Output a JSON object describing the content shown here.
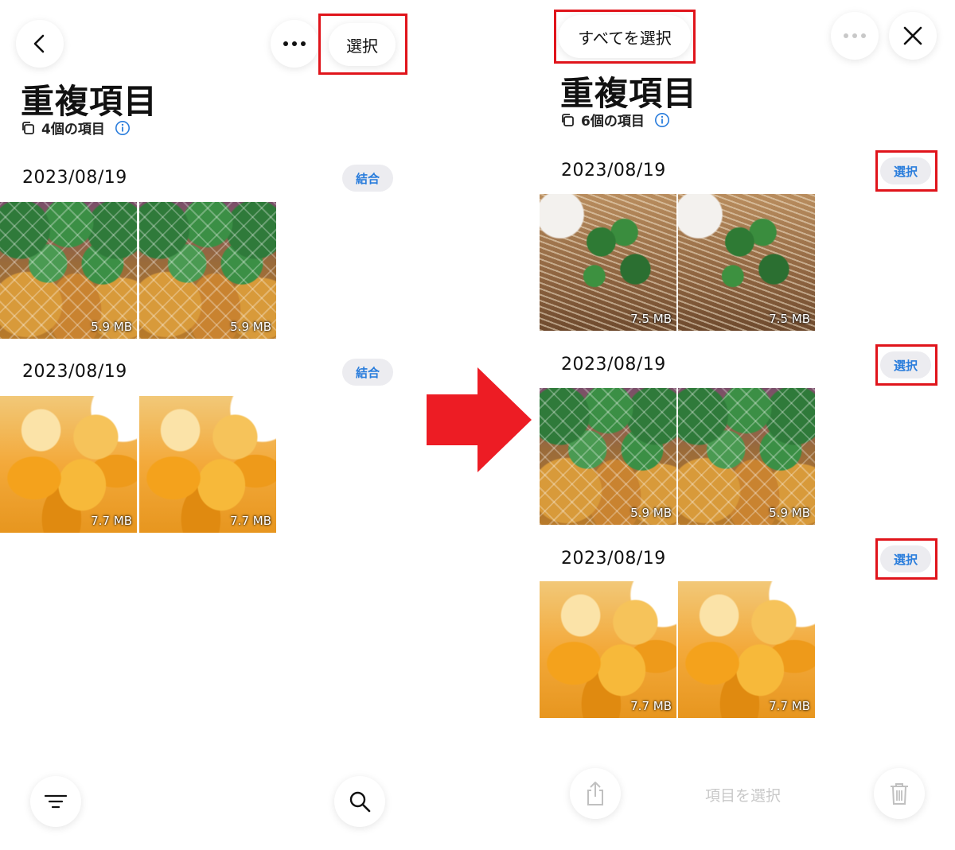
{
  "left": {
    "header": {
      "select_label": "選択"
    },
    "title": "重複項目",
    "subtitle": "4個の項目",
    "groups": [
      {
        "date": "2023/08/19",
        "action_label": "結合",
        "photos": [
          {
            "kind": "pineapple",
            "size": "5.9 MB"
          },
          {
            "kind": "pineapple",
            "size": "5.9 MB"
          }
        ]
      },
      {
        "date": "2023/08/19",
        "action_label": "結合",
        "photos": [
          {
            "kind": "mango",
            "size": "7.7 MB"
          },
          {
            "kind": "mango",
            "size": "7.7 MB"
          }
        ]
      }
    ]
  },
  "right": {
    "header": {
      "select_all_label": "すべてを選択"
    },
    "title": "重複項目",
    "subtitle": "6個の項目",
    "groups": [
      {
        "date": "2023/08/19",
        "action_label": "選択",
        "photos": [
          {
            "kind": "noodle",
            "size": "7.5 MB"
          },
          {
            "kind": "noodle",
            "size": "7.5 MB"
          }
        ]
      },
      {
        "date": "2023/08/19",
        "action_label": "選択",
        "photos": [
          {
            "kind": "pineapple",
            "size": "5.9 MB"
          },
          {
            "kind": "pineapple",
            "size": "5.9 MB"
          }
        ]
      },
      {
        "date": "2023/08/19",
        "action_label": "選択",
        "photos": [
          {
            "kind": "mango",
            "size": "7.7 MB"
          },
          {
            "kind": "mango",
            "size": "7.7 MB"
          }
        ]
      }
    ],
    "bottom_prompt": "項目を選択"
  },
  "colors": {
    "accent_blue": "#2a7ddc",
    "highlight_red": "#e0141b",
    "pill_gray": "#ececf0"
  },
  "icons": {
    "back": "chevron-left-icon",
    "more": "ellipsis-icon",
    "close": "close-icon",
    "filter": "filter-icon",
    "search": "search-icon",
    "share": "share-icon",
    "trash": "trash-icon",
    "duplicate": "duplicate-icon",
    "info": "info-icon",
    "arrow": "right-arrow-icon"
  }
}
